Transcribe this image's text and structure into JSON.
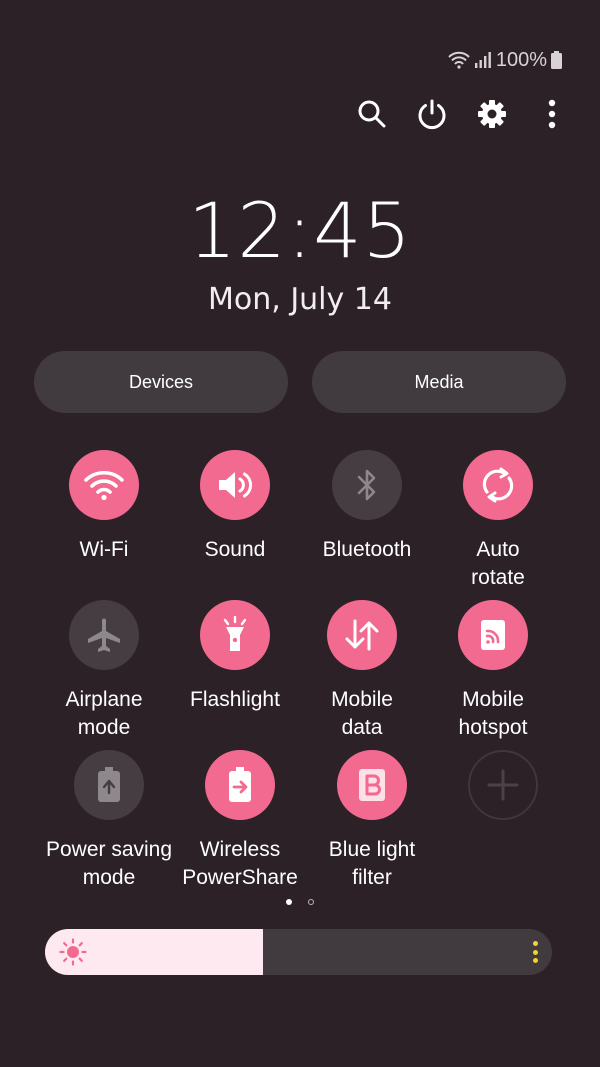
{
  "status_bar": {
    "battery_text": "100%"
  },
  "toolbar": {
    "items": [
      {
        "name": "search-icon"
      },
      {
        "name": "power-icon"
      },
      {
        "name": "settings-gear-icon"
      },
      {
        "name": "more-options-icon"
      }
    ]
  },
  "clock": {
    "time": "12:45",
    "date": "Mon, July 14"
  },
  "pills": {
    "devices": "Devices",
    "media": "Media"
  },
  "tiles": [
    {
      "label": "Wi-Fi",
      "icon": "wifi-icon",
      "state": "on"
    },
    {
      "label": "Sound",
      "icon": "sound-icon",
      "state": "on"
    },
    {
      "label": "Bluetooth",
      "icon": "bluetooth-icon",
      "state": "off"
    },
    {
      "label": "Auto\nrotate",
      "icon": "auto-rotate-icon",
      "state": "on"
    },
    {
      "label": "Airplane\nmode",
      "icon": "airplane-icon",
      "state": "off"
    },
    {
      "label": "Flashlight",
      "icon": "flashlight-icon",
      "state": "on"
    },
    {
      "label": "Mobile\ndata",
      "icon": "mobile-data-icon",
      "state": "on"
    },
    {
      "label": "Mobile\nhotspot",
      "icon": "hotspot-icon",
      "state": "on"
    },
    {
      "label": "Power saving\nmode",
      "icon": "power-saving-icon",
      "state": "off"
    },
    {
      "label": "Wireless\nPowerShare",
      "icon": "wireless-powershare-icon",
      "state": "on"
    },
    {
      "label": "Blue light\nfilter",
      "icon": "blue-light-filter-icon",
      "state": "on"
    },
    {
      "label": "",
      "icon": "add-icon",
      "state": "add"
    }
  ],
  "pager": {
    "page": 1,
    "total": 2
  },
  "brightness": {
    "level": 0.43
  },
  "colors": {
    "accent": "#f36a91",
    "tile_off": "#453d41",
    "background": "#2b2126",
    "brightness_fill": "#fde9ef",
    "sun": "#f36a91"
  }
}
